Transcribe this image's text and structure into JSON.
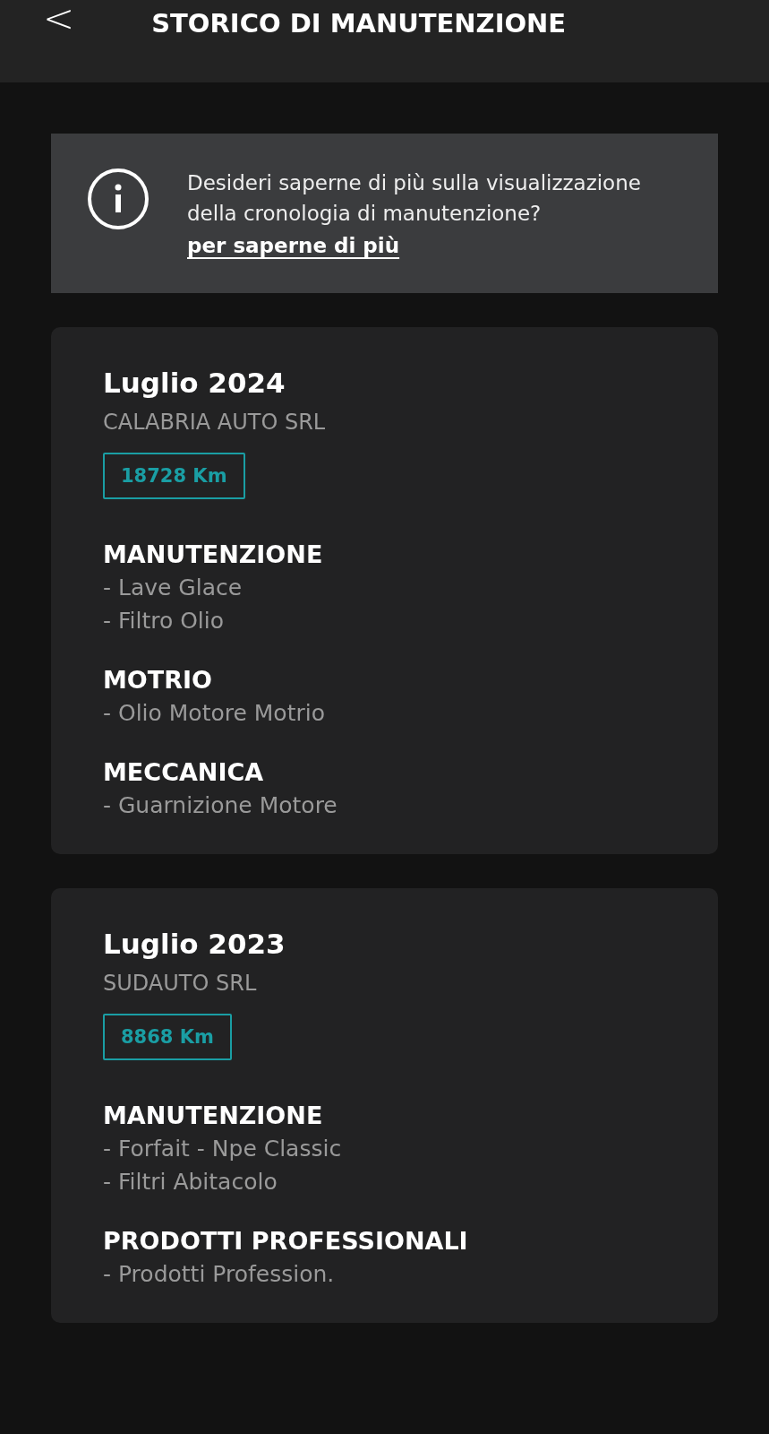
{
  "header": {
    "back": "<",
    "title": "STORICO DI MANUTENZIONE"
  },
  "info": {
    "text": "Desideri saperne di più sulla visualizzazione della cronologia di manutenzione?",
    "link": "per saperne di più"
  },
  "records": [
    {
      "date": "Luglio 2024",
      "dealer": "CALABRIA AUTO SRL",
      "mileage": "18728 Km",
      "sections": [
        {
          "title": "MANUTENZIONE",
          "items": [
            "- Lave Glace",
            "- Filtro Olio"
          ]
        },
        {
          "title": "MOTRIO",
          "items": [
            "- Olio Motore Motrio"
          ]
        },
        {
          "title": "MECCANICA",
          "items": [
            "- Guarnizione Motore"
          ]
        }
      ]
    },
    {
      "date": "Luglio 2023",
      "dealer": "SUDAUTO SRL",
      "mileage": "8868 Km",
      "sections": [
        {
          "title": "MANUTENZIONE",
          "items": [
            "- Forfait - Npe Classic",
            "- Filtri Abitacolo"
          ]
        },
        {
          "title": "PRODOTTI PROFESSIONALI",
          "items": [
            "- Prodotti Profession."
          ]
        }
      ]
    }
  ]
}
